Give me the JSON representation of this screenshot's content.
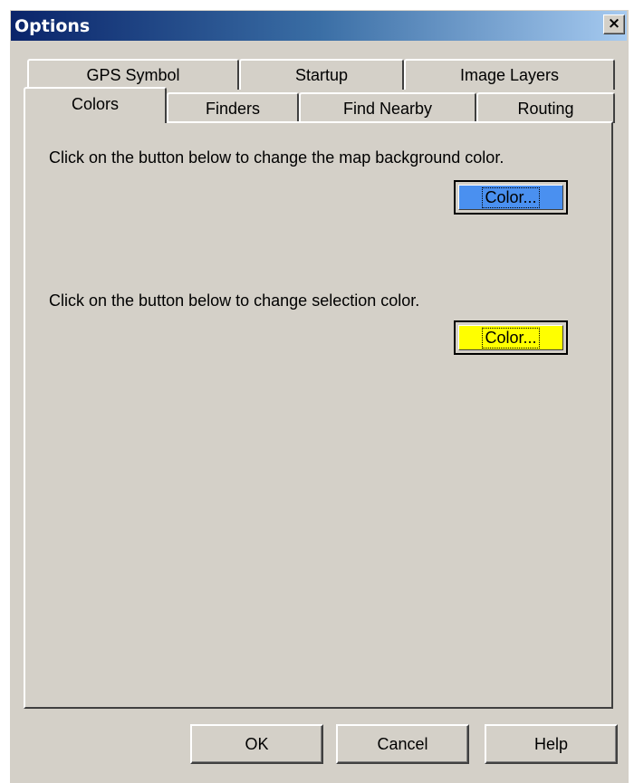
{
  "window": {
    "title": "Options",
    "close_label": "×"
  },
  "tabs": {
    "back_row": [
      "GPS Symbol",
      "Startup",
      "Image Layers"
    ],
    "front_row": [
      "Colors",
      "Finders",
      "Find Nearby",
      "Routing"
    ],
    "selected": "Colors"
  },
  "colors_tab": {
    "background_instruction": "Click on the button below to change the map background color.",
    "background_button_label": "Color...",
    "background_color": "#4a90f0",
    "selection_instruction": "Click on the button below to change selection color.",
    "selection_button_label": "Color...",
    "selection_color": "#ffff00"
  },
  "buttons": {
    "ok": "OK",
    "cancel": "Cancel",
    "help": "Help"
  }
}
